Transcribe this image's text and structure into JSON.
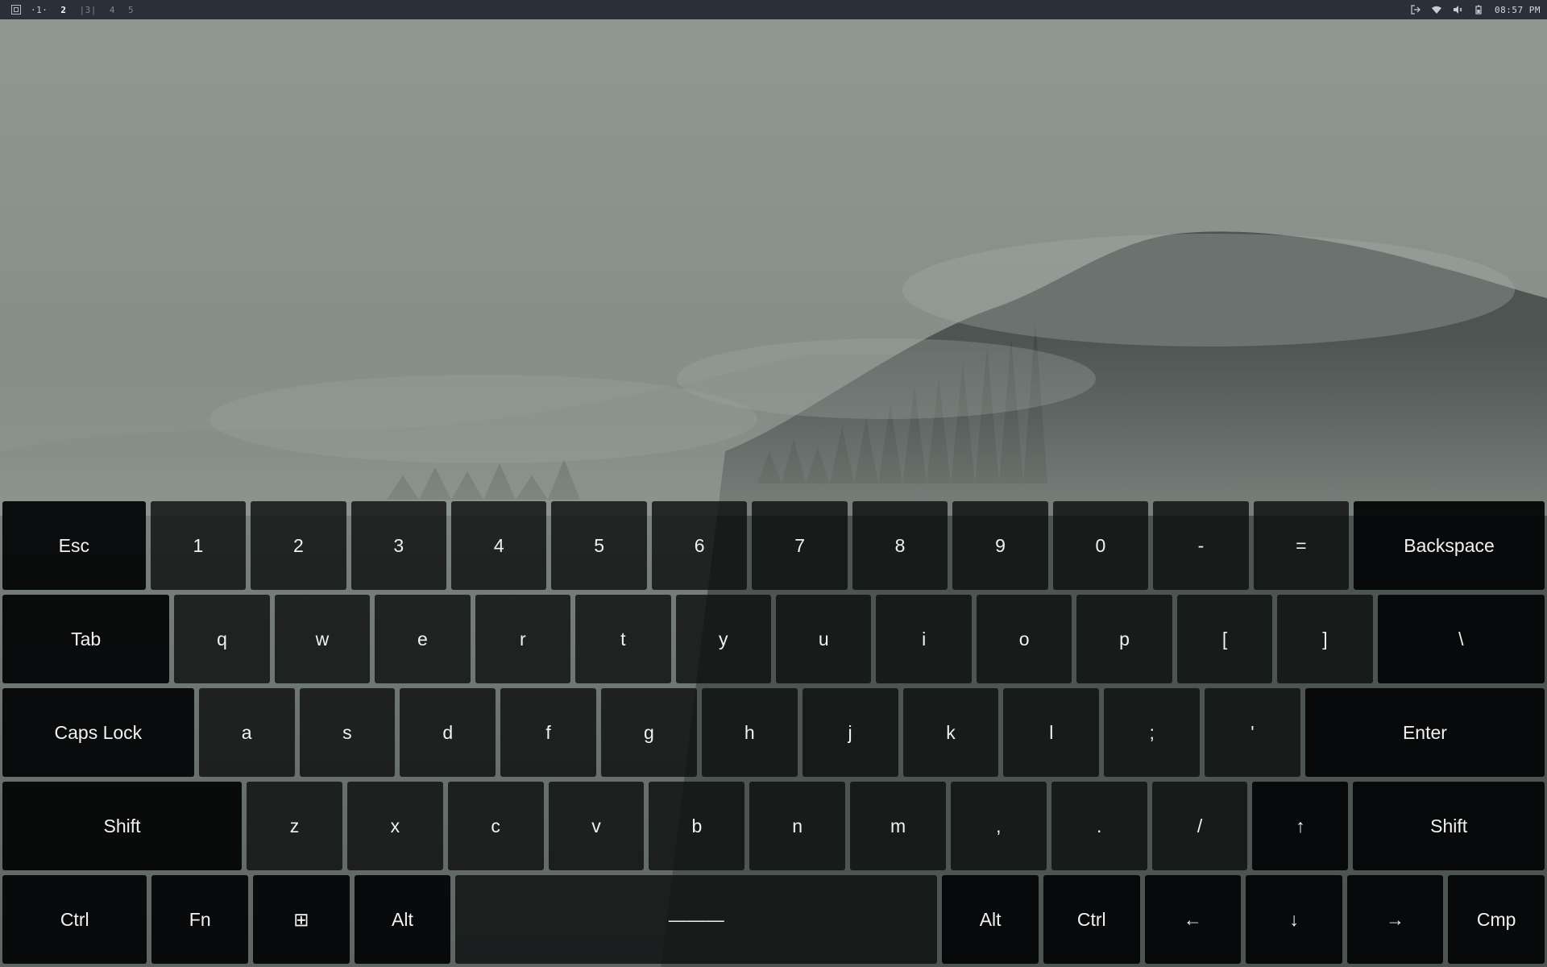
{
  "topbar": {
    "workspaces": [
      "·1·",
      "2",
      "|3|",
      "4",
      "5"
    ],
    "tray_icons": [
      "logout-icon",
      "wifi-icon",
      "volume-icon",
      "battery-icon"
    ],
    "clock": "08:57 PM"
  },
  "keyboard": {
    "rows": [
      [
        {
          "label": "Esc",
          "name": "key-esc",
          "w": 1.5,
          "mod": true
        },
        {
          "label": "1",
          "name": "key-1"
        },
        {
          "label": "2",
          "name": "key-2"
        },
        {
          "label": "3",
          "name": "key-3"
        },
        {
          "label": "4",
          "name": "key-4"
        },
        {
          "label": "5",
          "name": "key-5"
        },
        {
          "label": "6",
          "name": "key-6"
        },
        {
          "label": "7",
          "name": "key-7"
        },
        {
          "label": "8",
          "name": "key-8"
        },
        {
          "label": "9",
          "name": "key-9"
        },
        {
          "label": "0",
          "name": "key-0"
        },
        {
          "label": "-",
          "name": "key-minus"
        },
        {
          "label": "=",
          "name": "key-equals"
        },
        {
          "label": "Backspace",
          "name": "key-backspace",
          "w": 2.0,
          "mod": true
        }
      ],
      [
        {
          "label": "Tab",
          "name": "key-tab",
          "w": 1.75,
          "mod": true
        },
        {
          "label": "q",
          "name": "key-q"
        },
        {
          "label": "w",
          "name": "key-w"
        },
        {
          "label": "e",
          "name": "key-e"
        },
        {
          "label": "r",
          "name": "key-r"
        },
        {
          "label": "t",
          "name": "key-t"
        },
        {
          "label": "y",
          "name": "key-y"
        },
        {
          "label": "u",
          "name": "key-u"
        },
        {
          "label": "i",
          "name": "key-i"
        },
        {
          "label": "o",
          "name": "key-o"
        },
        {
          "label": "p",
          "name": "key-p"
        },
        {
          "label": "[",
          "name": "key-left-bracket"
        },
        {
          "label": "]",
          "name": "key-right-bracket"
        },
        {
          "label": "\\",
          "name": "key-backslash",
          "w": 1.75,
          "mod": true
        }
      ],
      [
        {
          "label": "Caps Lock",
          "name": "key-caps-lock",
          "w": 2.0,
          "mod": true
        },
        {
          "label": "a",
          "name": "key-a"
        },
        {
          "label": "s",
          "name": "key-s"
        },
        {
          "label": "d",
          "name": "key-d"
        },
        {
          "label": "f",
          "name": "key-f"
        },
        {
          "label": "g",
          "name": "key-g"
        },
        {
          "label": "h",
          "name": "key-h"
        },
        {
          "label": "j",
          "name": "key-j"
        },
        {
          "label": "k",
          "name": "key-k"
        },
        {
          "label": "l",
          "name": "key-l"
        },
        {
          "label": ";",
          "name": "key-semicolon"
        },
        {
          "label": "'",
          "name": "key-apostrophe"
        },
        {
          "label": "Enter",
          "name": "key-enter",
          "w": 2.5,
          "mod": true
        }
      ],
      [
        {
          "label": "Shift",
          "name": "key-shift-left",
          "w": 2.5,
          "mod": true
        },
        {
          "label": "z",
          "name": "key-z"
        },
        {
          "label": "x",
          "name": "key-x"
        },
        {
          "label": "c",
          "name": "key-c"
        },
        {
          "label": "v",
          "name": "key-v"
        },
        {
          "label": "b",
          "name": "key-b"
        },
        {
          "label": "n",
          "name": "key-n"
        },
        {
          "label": "m",
          "name": "key-m"
        },
        {
          "label": ",",
          "name": "key-comma"
        },
        {
          "label": ".",
          "name": "key-period"
        },
        {
          "label": "/",
          "name": "key-slash"
        },
        {
          "label": "↑",
          "name": "key-arrow-up",
          "mod": true
        },
        {
          "label": "Shift",
          "name": "key-shift-right",
          "w": 2.0,
          "mod": true
        }
      ],
      [
        {
          "label": "Ctrl",
          "name": "key-ctrl-left",
          "w": 1.5,
          "mod": true
        },
        {
          "label": "Fn",
          "name": "key-fn",
          "mod": true
        },
        {
          "label": "⊞",
          "name": "key-super",
          "mod": true
        },
        {
          "label": "Alt",
          "name": "key-alt-left",
          "mod": true
        },
        {
          "label": "———",
          "name": "key-space",
          "w": 5.0
        },
        {
          "label": "Alt",
          "name": "key-alt-right",
          "mod": true
        },
        {
          "label": "Ctrl",
          "name": "key-ctrl-right",
          "mod": true
        },
        {
          "label": "←",
          "name": "key-arrow-left",
          "mod": true
        },
        {
          "label": "↓",
          "name": "key-arrow-down",
          "mod": true
        },
        {
          "label": "→",
          "name": "key-arrow-right",
          "mod": true
        },
        {
          "label": "Cmp",
          "name": "key-compose",
          "mod": true
        }
      ]
    ]
  }
}
